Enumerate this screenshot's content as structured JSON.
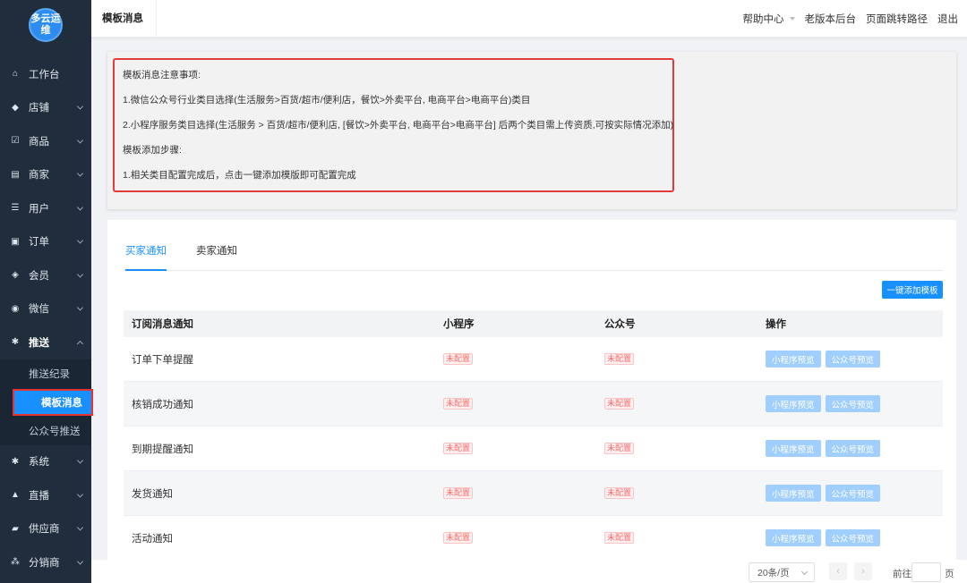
{
  "logo": {
    "text": "多云运维"
  },
  "sidebar": {
    "items": [
      {
        "label": "工作台",
        "icon": "home-icon",
        "glyph": "⌂",
        "arrow": false
      },
      {
        "label": "店铺",
        "icon": "cube-icon",
        "glyph": "◆",
        "arrow": true
      },
      {
        "label": "商品",
        "icon": "checkbox-icon",
        "glyph": "☑",
        "arrow": true
      },
      {
        "label": "商家",
        "icon": "store-icon",
        "glyph": "▤",
        "arrow": true
      },
      {
        "label": "用户",
        "icon": "user-list-icon",
        "glyph": "☰",
        "arrow": true
      },
      {
        "label": "订单",
        "icon": "order-icon",
        "glyph": "▣",
        "arrow": true
      },
      {
        "label": "会员",
        "icon": "diamond-icon",
        "glyph": "◈",
        "arrow": true
      },
      {
        "label": "微信",
        "icon": "wechat-icon",
        "glyph": "◉",
        "arrow": true
      },
      {
        "label": "推送",
        "icon": "gear-icon",
        "glyph": "✱",
        "arrow": true,
        "open": true
      }
    ],
    "sub_items": [
      {
        "label": "推送纪录"
      },
      {
        "label": "模板消息",
        "active": true
      },
      {
        "label": "公众号推送"
      }
    ],
    "items_after": [
      {
        "label": "系统",
        "icon": "settings-icon",
        "glyph": "✱",
        "arrow": true
      },
      {
        "label": "直播",
        "icon": "live-icon",
        "glyph": "▲",
        "arrow": true
      },
      {
        "label": "供应商",
        "icon": "truck-icon",
        "glyph": "▰",
        "arrow": true
      },
      {
        "label": "分销商",
        "icon": "network-icon",
        "glyph": "⁂",
        "arrow": true
      }
    ]
  },
  "topbar": {
    "tab": "模板消息",
    "links": [
      "帮助中心",
      "老版本后台",
      "页面跳转路径",
      "退出"
    ]
  },
  "notice": {
    "lines": [
      "模板消息注意事项:",
      "1.微信公众号行业类目选择(生活服务>百货/超市/便利店，餐饮>外卖平台, 电商平台>电商平台)类目",
      "2.小程序服务类目选择(生活服务 > 百货/超市/便利店, [餐饮>外卖平台, 电商平台>电商平台] 后两个类目需上传资质,可按实际情况添加)",
      "模板添加步骤:",
      "1.相关类目配置完成后，点击一键添加模版即可配置完成"
    ]
  },
  "tabs": {
    "buyer": "买家通知",
    "seller": "卖家通知"
  },
  "add_button": "一键添加模板",
  "table": {
    "headers": [
      "订阅消息通知",
      "小程序",
      "公众号",
      "操作"
    ],
    "rows": [
      {
        "name": "订单下单提醒",
        "mini": "未配置",
        "mp": "未配置"
      },
      {
        "name": "核销成功通知",
        "mini": "未配置",
        "mp": "未配置"
      },
      {
        "name": "到期提醒通知",
        "mini": "未配置",
        "mp": "未配置"
      },
      {
        "name": "发货通知",
        "mini": "未配置",
        "mp": "未配置"
      },
      {
        "name": "活动通知",
        "mini": "未配置",
        "mp": "未配置"
      }
    ],
    "actions": {
      "mini_preview": "小程序预览",
      "mp_preview": "公众号预览"
    }
  },
  "pager": {
    "size": "20条/页",
    "goto": "前往",
    "unit": "页"
  },
  "colors": {
    "primary": "#1890ff",
    "sidebar_bg": "#1f2d3d",
    "highlight_border": "#e23b3b",
    "tag_red": "#f56c6c"
  }
}
